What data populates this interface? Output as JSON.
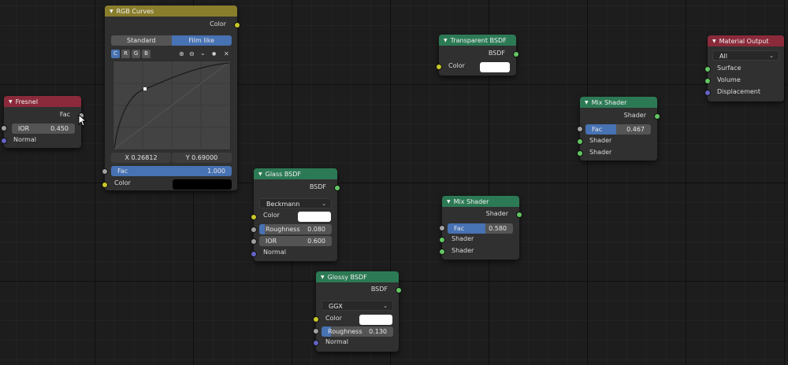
{
  "colors": {
    "input_header": "#8b2a3a",
    "converter_header": "#8a7e2c",
    "shader_header": "#2c7a55",
    "accent": "#4772b3",
    "socket_gray": "#a1a1a1",
    "socket_green": "#63c763",
    "socket_yellow": "#c7c729",
    "socket_blue": "#6363c7"
  },
  "fresnel": {
    "title": "Fresnel",
    "out_fac": "Fac",
    "ior_label": "IOR",
    "ior_value": "0.450",
    "normal_label": "Normal"
  },
  "rgb_curves": {
    "title": "RGB Curves",
    "out_color": "Color",
    "tabs": [
      "Standard",
      "Film like"
    ],
    "active_tab": "Film like",
    "channels": [
      "C",
      "R",
      "G",
      "B"
    ],
    "active_channel": "C",
    "tools": {
      "zoom_in": "⊕",
      "zoom_out": "⊖",
      "menu": "⌄",
      "clip": "●",
      "reset": "✕"
    },
    "point_x": "X 0.26812",
    "point_y": "Y 0.69000",
    "fac_label": "Fac",
    "fac_value": "1.000",
    "fac_fraction": 1.0,
    "color_label": "Color",
    "color_swatch": "#000000"
  },
  "transparent_bsdf": {
    "title": "Transparent BSDF",
    "out_bsdf": "BSDF",
    "color_label": "Color",
    "color_swatch": "#ffffff"
  },
  "material_output": {
    "title": "Material Output",
    "target": "All",
    "surface": "Surface",
    "volume": "Volume",
    "displacement": "Displacement"
  },
  "mix_shader_1": {
    "title": "Mix Shader",
    "out_shader": "Shader",
    "fac_label": "Fac",
    "fac_value": "0.467",
    "fac_fraction": 0.467,
    "shader_a": "Shader",
    "shader_b": "Shader"
  },
  "glass_bsdf": {
    "title": "Glass BSDF",
    "out_bsdf": "BSDF",
    "distribution": "Beckmann",
    "color_label": "Color",
    "color_swatch": "#ffffff",
    "roughness_label": "Roughness",
    "roughness_value": "0.080",
    "roughness_fraction": 0.08,
    "ior_label": "IOR",
    "ior_value": "0.600",
    "normal_label": "Normal"
  },
  "mix_shader_2": {
    "title": "Mix Shader",
    "out_shader": "Shader",
    "fac_label": "Fac",
    "fac_value": "0.580",
    "fac_fraction": 0.58,
    "shader_a": "Shader",
    "shader_b": "Shader"
  },
  "glossy_bsdf": {
    "title": "Glossy BSDF",
    "out_bsdf": "BSDF",
    "distribution": "GGX",
    "color_label": "Color",
    "color_swatch": "#ffffff",
    "roughness_label": "Roughness",
    "roughness_value": "0.130",
    "roughness_fraction": 0.13,
    "normal_label": "Normal"
  }
}
